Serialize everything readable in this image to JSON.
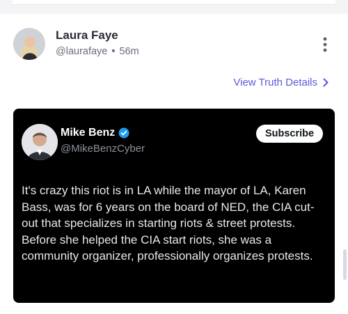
{
  "post": {
    "author_name": "Laura Faye",
    "author_handle": "@laurafaye",
    "time_ago": "56m",
    "separator": "•",
    "view_details_label": "View Truth Details"
  },
  "embed": {
    "name": "Mike Benz",
    "handle": "@MikeBenzCyber",
    "subscribe_label": "Subscribe",
    "text": "It's crazy this riot is in LA while the mayor of LA, Karen Bass, was for 6 years on the board of NED, the CIA cut-out that specializes in starting riots & street protests. Before she helped the CIA start riots, she was a community organizer, professionally organizes protests."
  },
  "colors": {
    "accent": "#5a57d8",
    "verified": "#1d9bf0",
    "embed_bg": "#000000"
  },
  "icons": [
    "more-vertical-icon",
    "chevron-right-icon",
    "verified-badge-icon"
  ]
}
